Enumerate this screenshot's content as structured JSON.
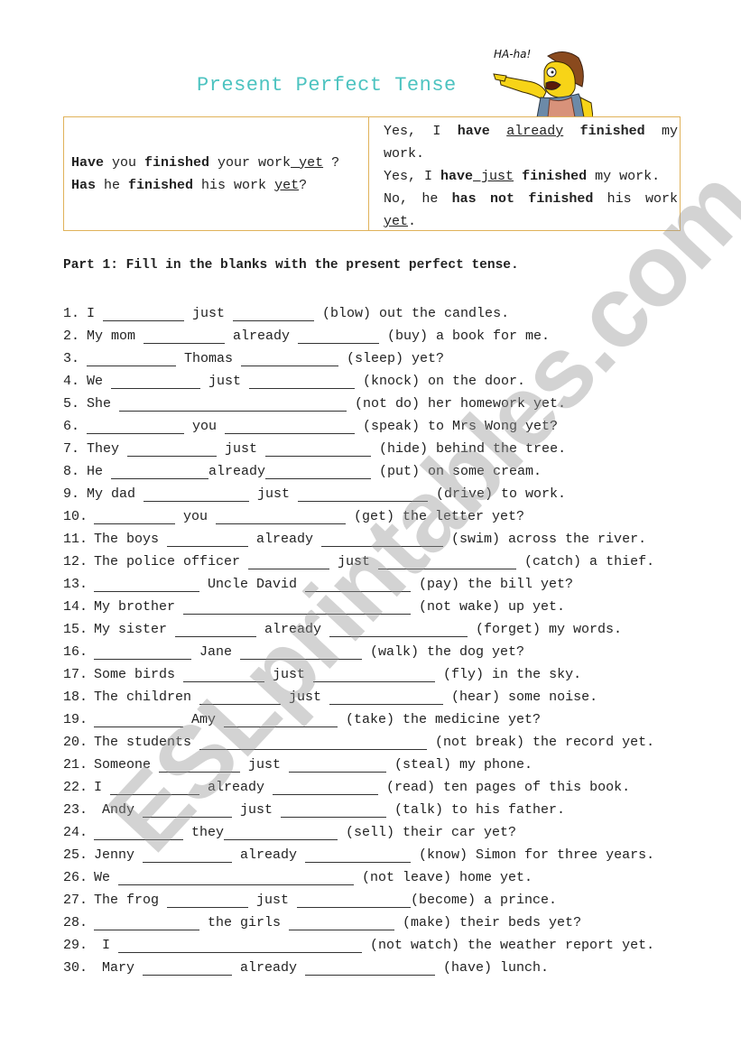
{
  "title": "Present Perfect Tense",
  "cartoon": {
    "speech": "HA-ha!",
    "icon": "pointing-cartoon-character-icon"
  },
  "examples": {
    "questions": [
      [
        {
          "t": "Have",
          "b": true
        },
        {
          "t": " you "
        },
        {
          "t": "finished",
          "b": true
        },
        {
          "t": " your work"
        },
        {
          "t": " yet",
          "u": true
        },
        {
          "t": " ?"
        }
      ],
      [
        {
          "t": "Has",
          "b": true
        },
        {
          "t": " he "
        },
        {
          "t": "finished",
          "b": true
        },
        {
          "t": " his work "
        },
        {
          "t": "yet",
          "u": true
        },
        {
          "t": "?"
        }
      ]
    ],
    "answers": [
      [
        {
          "t": "Yes, I "
        },
        {
          "t": "have",
          "b": true
        },
        {
          "t": " "
        },
        {
          "t": "already",
          "u": true
        },
        {
          "t": " "
        },
        {
          "t": "finished",
          "b": true
        },
        {
          "t": " my work."
        }
      ],
      [
        {
          "t": "Yes, I "
        },
        {
          "t": "have",
          "b": true
        },
        {
          "t": " just",
          "u": true
        },
        {
          "t": " "
        },
        {
          "t": "finished",
          "b": true
        },
        {
          "t": " my work."
        }
      ],
      [
        {
          "t": "No, he "
        },
        {
          "t": "has not finished",
          "b": true
        },
        {
          "t": " his work "
        },
        {
          "t": "yet",
          "u": true
        },
        {
          "t": "."
        }
      ]
    ]
  },
  "part1": {
    "heading": "Part 1: Fill in the blanks with the present perfect tense.",
    "items": [
      {
        "num": "1.",
        "parts": [
          "I ",
          "_9",
          " just ",
          "_9",
          " (blow) out the candles."
        ]
      },
      {
        "num": "2.",
        "parts": [
          "My mom ",
          "_9",
          " already ",
          "_9",
          " (buy) a book for me."
        ]
      },
      {
        "num": "3.",
        "parts": [
          "_10",
          " Thomas ",
          "_11",
          " (sleep) yet?"
        ]
      },
      {
        "num": "4.",
        "parts": [
          "We ",
          "_10",
          " just ",
          "_12",
          " (knock) on the door."
        ]
      },
      {
        "num": "5.",
        "parts": [
          "She ",
          "_27",
          " (not do) her homework yet."
        ]
      },
      {
        "num": "6.",
        "parts": [
          "_11",
          " you ",
          "_15",
          " (speak) to Mrs Wong yet?"
        ]
      },
      {
        "num": "7.",
        "parts": [
          "They ",
          "_10",
          " just ",
          "_12",
          " (hide) behind the tree."
        ]
      },
      {
        "num": "8.",
        "parts": [
          "He ",
          "_11",
          "already",
          "_12",
          " (put) on some cream."
        ]
      },
      {
        "num": "9.",
        "parts": [
          "My dad ",
          "_12",
          " just ",
          "_15",
          " (drive) to work."
        ]
      },
      {
        "num": "10.",
        "parts": [
          "_9",
          " you ",
          "_15",
          " (get) the letter yet?"
        ]
      },
      {
        "num": "11.",
        "parts": [
          "The boys ",
          "_9",
          " already ",
          "_14",
          " (swim) across the river."
        ]
      },
      {
        "num": "12.",
        "parts": [
          "The police officer ",
          "_9",
          " just ",
          "_16",
          " (catch) a thief."
        ]
      },
      {
        "num": "13.",
        "parts": [
          "_12",
          " Uncle David ",
          "_12",
          " (pay) the bill yet?"
        ]
      },
      {
        "num": "14.",
        "parts": [
          "My brother ",
          "_27",
          " (not wake) up yet."
        ]
      },
      {
        "num": "15.",
        "parts": [
          "My sister ",
          "_9",
          " already ",
          "_16",
          " (forget) my words."
        ]
      },
      {
        "num": "16.",
        "parts": [
          "_11",
          " Jane ",
          "_14",
          " (walk) the dog yet?"
        ]
      },
      {
        "num": "17.",
        "parts": [
          "Some birds ",
          "_9",
          " just ",
          "_14",
          " (fly) in the sky."
        ]
      },
      {
        "num": "18.",
        "parts": [
          "The children ",
          "_9",
          " just ",
          "_13",
          " (hear) some noise."
        ]
      },
      {
        "num": "19.",
        "parts": [
          "_10",
          " Amy ",
          "_13",
          " (take) the medicine yet?"
        ]
      },
      {
        "num": "20.",
        "parts": [
          "The students ",
          "_27",
          " (not break) the record yet."
        ]
      },
      {
        "num": "21.",
        "parts": [
          "Someone ",
          "_9",
          " just ",
          "_11",
          " (steal) my phone."
        ]
      },
      {
        "num": "22.",
        "parts": [
          "I ",
          "_10",
          " already ",
          "_12",
          " (read) ten pages of this book."
        ]
      },
      {
        "num": "23.",
        "parts": [
          " Andy ",
          "_10",
          " just ",
          "_12",
          " (talk) to his father."
        ]
      },
      {
        "num": "24.",
        "parts": [
          "_10",
          " they",
          "_13",
          " (sell) their car yet?"
        ]
      },
      {
        "num": "25.",
        "parts": [
          "Jenny ",
          "_10",
          " already ",
          "_12",
          " (know) Simon for three years."
        ]
      },
      {
        "num": "26.",
        "parts": [
          "We ",
          "_28",
          " (not leave) home yet."
        ]
      },
      {
        "num": "27.",
        "parts": [
          "The frog ",
          "_9",
          " just ",
          "_13",
          "(become) a prince."
        ]
      },
      {
        "num": "28.",
        "parts": [
          "_12",
          " the girls ",
          "_12",
          " (make) their beds yet?"
        ]
      },
      {
        "num": "29.",
        "parts": [
          " I ",
          "_29",
          " (not watch) the weather report yet."
        ]
      },
      {
        "num": "30.",
        "parts": [
          " Mary ",
          "_10",
          " already ",
          "_15",
          " (have) lunch."
        ]
      }
    ]
  },
  "watermark": "ESLprintables.com",
  "colors": {
    "title": "#4cc3c0",
    "table_border": "#e0b25a",
    "watermark": "#969696"
  }
}
